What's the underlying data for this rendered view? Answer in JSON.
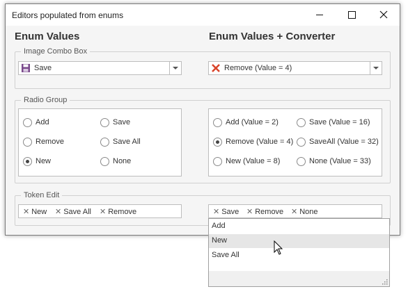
{
  "window": {
    "title": "Editors populated from enums"
  },
  "left": {
    "heading": "Enum Values",
    "image_combo": {
      "group_title": "Image Combo Box",
      "value": "Save",
      "icon": "floppy-disk-icon"
    },
    "radio_group": {
      "group_title": "Radio Group",
      "items": [
        {
          "label": "Add",
          "checked": false
        },
        {
          "label": "Save",
          "checked": false
        },
        {
          "label": "Remove",
          "checked": false
        },
        {
          "label": "Save All",
          "checked": false
        },
        {
          "label": "New",
          "checked": true
        },
        {
          "label": "None",
          "checked": false
        }
      ]
    },
    "token_edit": {
      "group_title": "Token Edit",
      "tokens": [
        "New",
        "Save All",
        "Remove"
      ]
    }
  },
  "right": {
    "heading": "Enum Values + Converter",
    "image_combo": {
      "value": "Remove (Value = 4)",
      "icon": "red-x-icon"
    },
    "radio_group": {
      "items": [
        {
          "label": "Add (Value = 2)",
          "checked": false
        },
        {
          "label": "Save (Value = 16)",
          "checked": false
        },
        {
          "label": "Remove (Value = 4)",
          "checked": true
        },
        {
          "label": "SaveAll (Value = 32)",
          "checked": false
        },
        {
          "label": "New (Value = 8)",
          "checked": false
        },
        {
          "label": "None (Value = 33)",
          "checked": false
        }
      ]
    },
    "token_edit": {
      "tokens": [
        "Save",
        "Remove",
        "None"
      ]
    }
  },
  "popup": {
    "items": [
      "Add",
      "New",
      "Save All"
    ],
    "hovered": "New"
  },
  "token_remove_glyph": "✕"
}
